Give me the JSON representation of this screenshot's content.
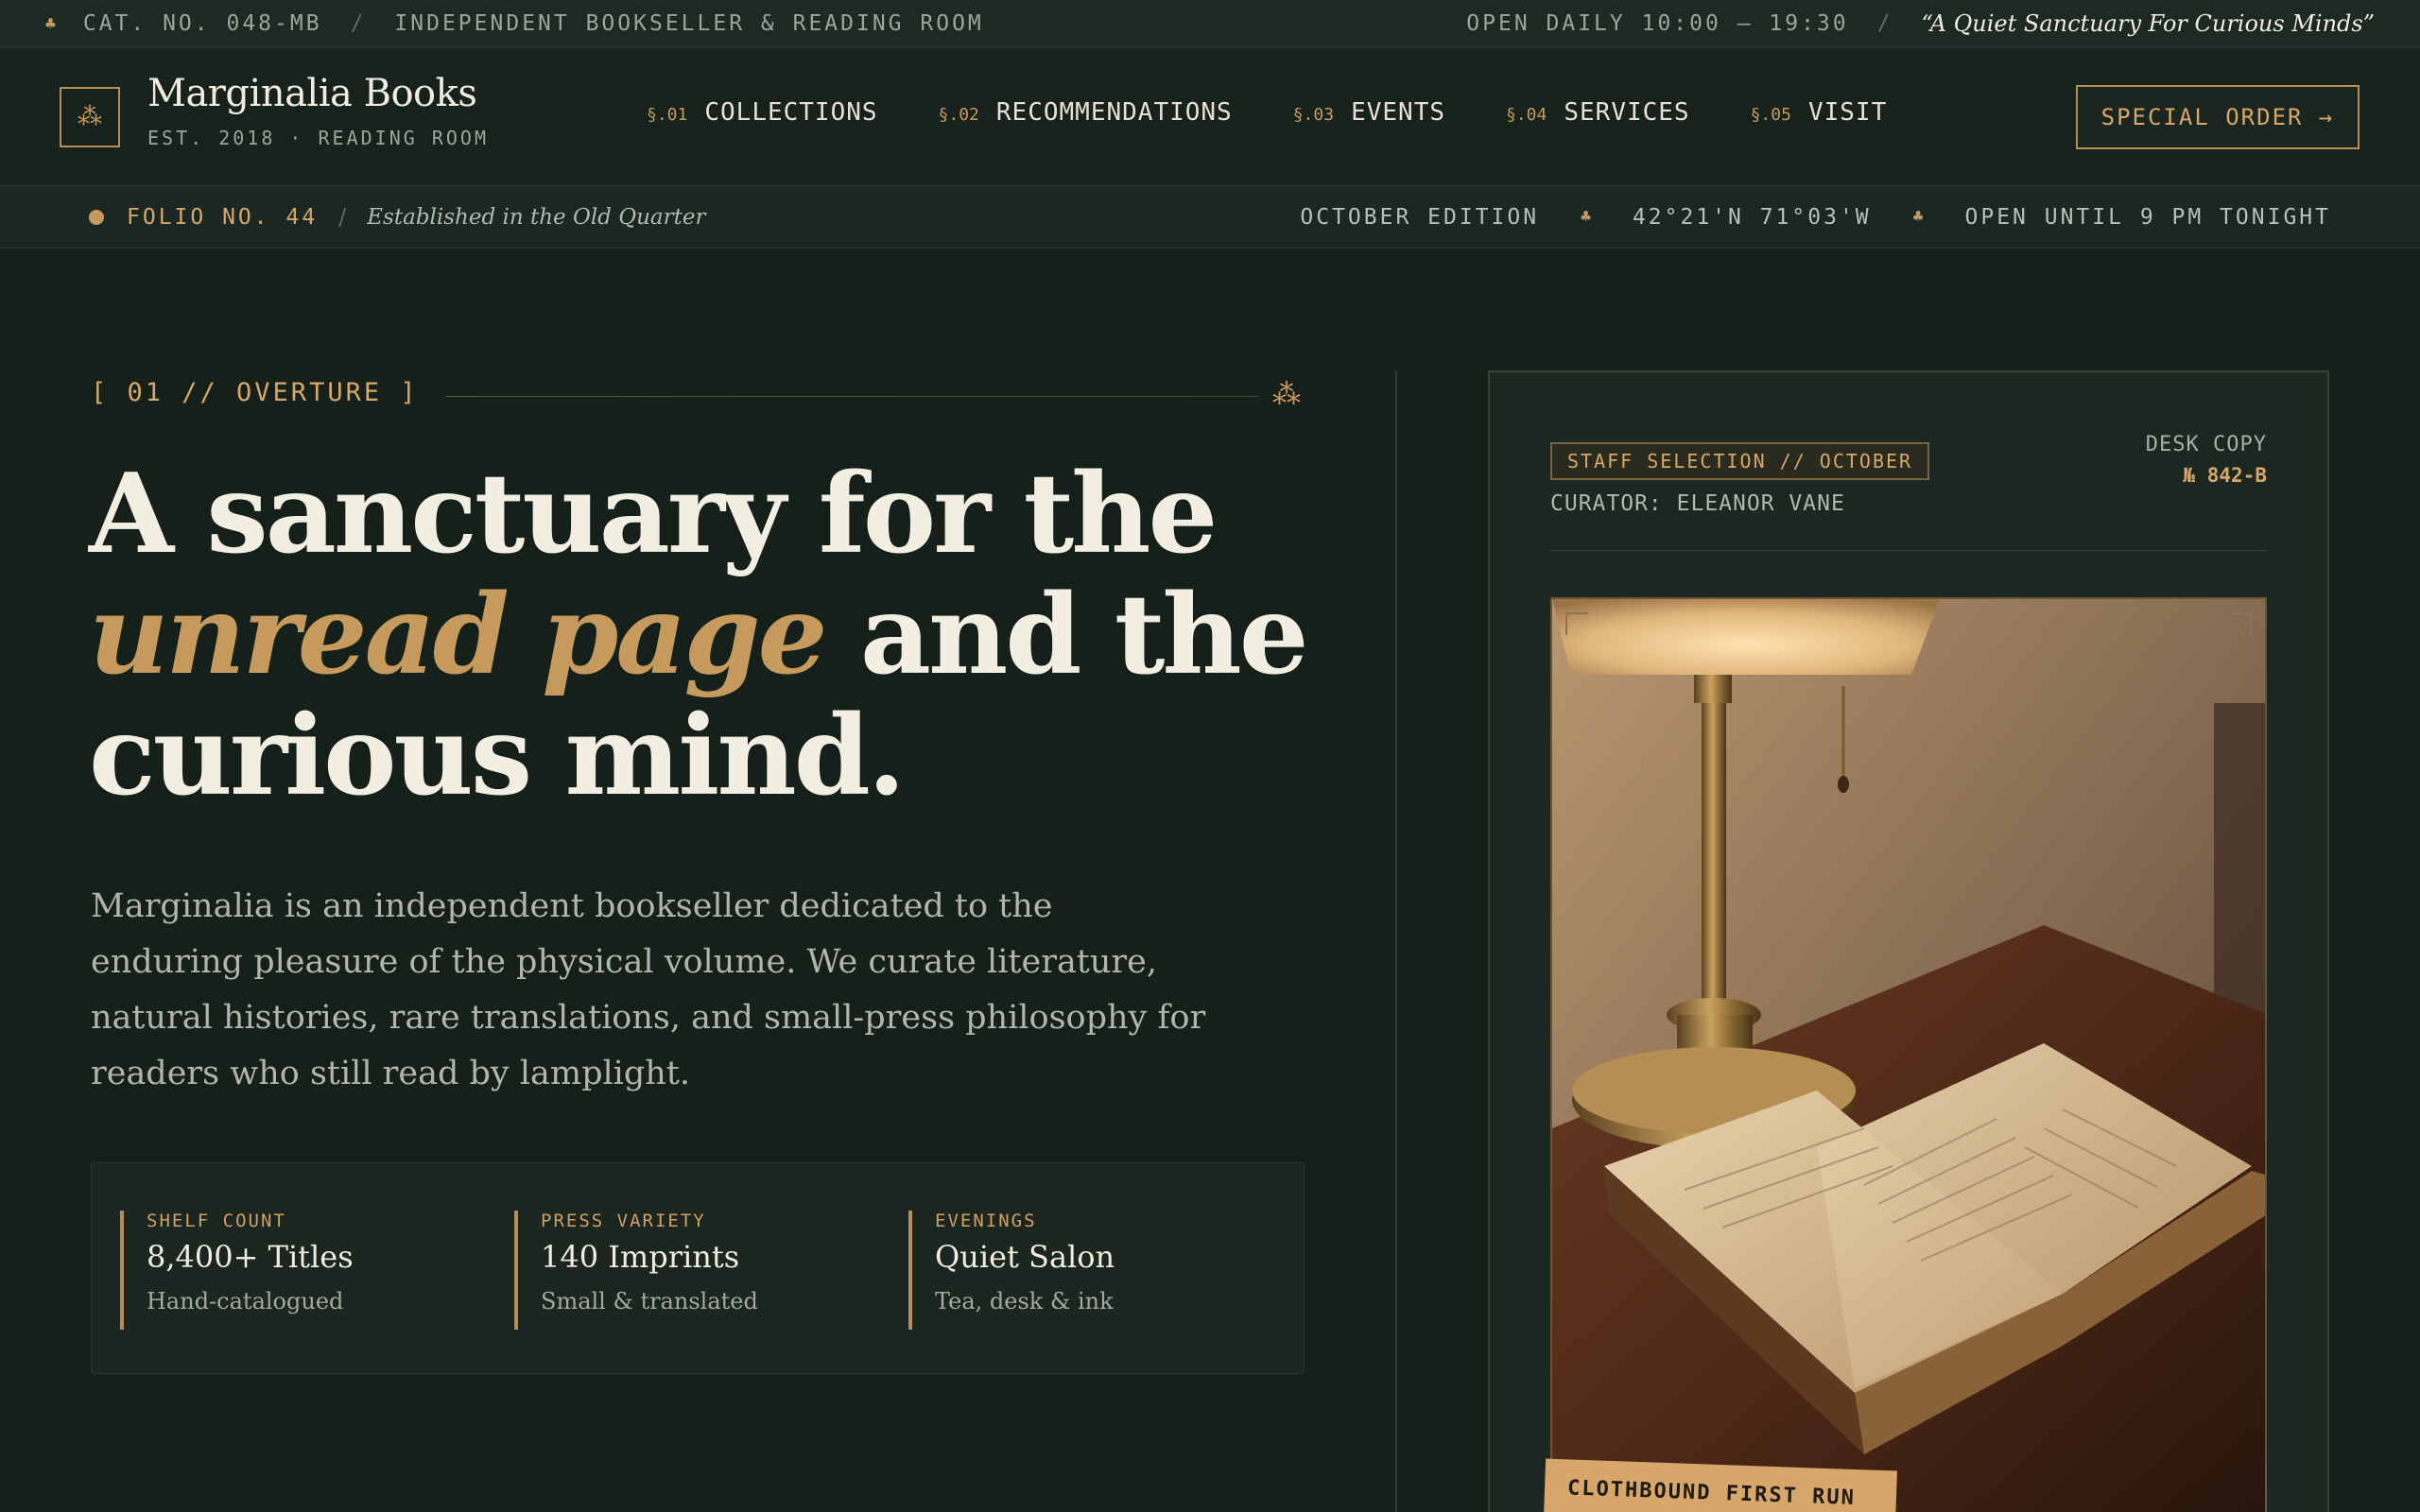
{
  "topbar": {
    "catalog": "CAT. NO. 048-MB",
    "descriptor": "INDEPENDENT BOOKSELLER & READING ROOM",
    "hours": "OPEN DAILY 10:00 – 19:30",
    "tagline": "“A Quiet Sanctuary For Curious Minds”"
  },
  "brand": {
    "name": "Marginalia Books",
    "subtitle": "EST. 2018 · READING ROOM",
    "mark_icon": "trefoil-icon"
  },
  "nav": [
    {
      "num": "§.01",
      "label": "COLLECTIONS"
    },
    {
      "num": "§.02",
      "label": "RECOMMENDATIONS"
    },
    {
      "num": "§.03",
      "label": "EVENTS"
    },
    {
      "num": "§.04",
      "label": "SERVICES"
    },
    {
      "num": "§.05",
      "label": "VISIT"
    }
  ],
  "cta": {
    "special_order": "SPECIAL ORDER →"
  },
  "strip": {
    "folio": "FOLIO NO. 44",
    "established": "Established in the Old Quarter",
    "edition": "OCTOBER EDITION",
    "coordinates": "42°21'N 71°03'W",
    "open_until": "OPEN UNTIL 9 PM TONIGHT"
  },
  "hero": {
    "section_label": "[ 01 // OVERTURE ]",
    "headline_part1": "A sanctuary for the ",
    "headline_em1": "unread",
    "headline_em2": "page",
    "headline_part2": " and the curious mind.",
    "lede": "Marginalia is an independent bookseller dedicated to the enduring pleasure of the physical volume. We curate literature, natural histories, rare translations, and small-press philosophy for readers who still read by lamplight."
  },
  "stats": [
    {
      "key": "SHELF COUNT",
      "value": "8,400+ Titles",
      "sub": "Hand-catalogued"
    },
    {
      "key": "PRESS VARIETY",
      "value": "140 Imprints",
      "sub": "Small & translated"
    },
    {
      "key": "EVENINGS",
      "value": "Quiet Salon",
      "sub": "Tea, desk & ink"
    }
  ],
  "card": {
    "chip": "STAFF SELECTION // OCTOBER",
    "curator": "CURATOR: ELEANOR VANE",
    "desk_label": "DESK COPY",
    "desk_code": "№ 842-B",
    "tape_label": "CLOTHBOUND FIRST RUN"
  },
  "colors": {
    "background": "#16201b",
    "accent_gold": "#c59a5c",
    "text_light": "#f3eee2",
    "text_muted": "#b3b5aa"
  }
}
